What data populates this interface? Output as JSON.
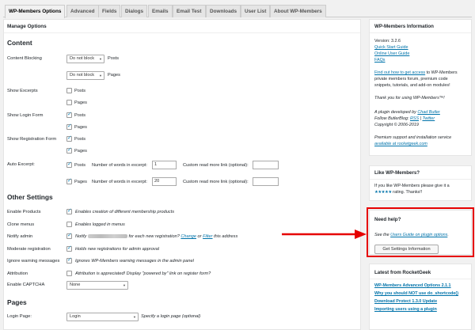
{
  "tabs": [
    "WP-Members Options",
    "Advanced",
    "Fields",
    "Dialogs",
    "Emails",
    "Email Test",
    "Downloads",
    "User List",
    "About WP-Members"
  ],
  "main": {
    "panel_title": "Manage Options",
    "content_heading": "Content",
    "content_blocking": {
      "label": "Content Blocking",
      "posts_value": "Do not block",
      "posts_label": "Posts",
      "pages_value": "Do not block",
      "pages_label": "Pages"
    },
    "show_excerpts": {
      "label": "Show Excerpts",
      "posts": "Posts",
      "pages": "Pages"
    },
    "show_login": {
      "label": "Show Login Form",
      "posts": "Posts",
      "pages": "Pages"
    },
    "show_registration": {
      "label": "Show Registration Form",
      "posts": "Posts",
      "pages": "Pages"
    },
    "auto_excerpt": {
      "label": "Auto Excerpt:",
      "posts": "Posts",
      "pages": "Pages",
      "words_label": "Number of words in excerpt:",
      "posts_words": "1",
      "pages_words": "20",
      "readmore_label": "Custom read more link (optional):"
    },
    "other_heading": "Other Settings",
    "enable_products": {
      "label": "Enable Products",
      "desc": "Enables creation of different membership products"
    },
    "clone_menus": {
      "label": "Clone menus",
      "desc": "Enables logged in menus"
    },
    "notify_admin": {
      "label": "Notify admin",
      "pre": "Notify",
      "mid": "for each new registration?",
      "change": "Change",
      "or": "or",
      "filter": "Filter",
      "post": "this address"
    },
    "moderate": {
      "label": "Moderate registration",
      "desc": "Holds new registrations for admin approval"
    },
    "ignore_warnings": {
      "label": "Ignore warning messages",
      "desc": "Ignores WP-Members warning messages in the admin panel"
    },
    "attribution": {
      "label": "Attribution",
      "desc": "Attribution is appreciated! Display \"powered by\" link on register form?"
    },
    "captcha": {
      "label": "Enable CAPTCHA",
      "value": "None"
    },
    "pages_heading": "Pages",
    "login_page": {
      "label": "Login Page:",
      "value": "Login",
      "desc": "Specify a login page (optional)"
    }
  },
  "sidebar": {
    "info": {
      "title": "WP-Members Information",
      "version": "Version: 3.2.6",
      "quick_start": "Quick Start Guide",
      "online_guide": "Online User Guide",
      "faqs": "FAQs",
      "promo_link": "Find out how to get access",
      "promo_rest": "to WP-Members",
      "promo_line2": "private members forum, premium code",
      "promo_line3": "snippets, tutorials, and add-on modules!",
      "thanks": "Thank you for using WP-Members™!",
      "dev_pre": "A plugin developed by",
      "dev_name": "Chad Butler",
      "follow_pre": "Follow ButlerBlog:",
      "rss": "RSS",
      "sep": "|",
      "twitter": "Twitter",
      "copyright": "Copyright © 2006-2019",
      "premium_line1": "Premium support and installation service",
      "premium_line2": "available at rocketgeek.com"
    },
    "like": {
      "title": "Like WP-Members?",
      "line1": "If you like WP-Members please give it a",
      "stars": "★★★★★",
      "line2": "rating. Thanks!!"
    },
    "help": {
      "title": "Need help?",
      "pre": "See the",
      "link": "Users Guide on plugin options",
      "post": ".",
      "button": "Get Settings Information"
    },
    "latest": {
      "title": "Latest from RocketGeek",
      "items": [
        "WP-Members Advanced Options 2.1.1",
        "Why you should NOT use do_shortcode()",
        "Download Protect 1.3.0 Update",
        "Importing users using a plugin"
      ]
    }
  },
  "colors": {
    "accent": "#0073aa",
    "check": "#1e8cbe",
    "highlight": "#e60000"
  }
}
